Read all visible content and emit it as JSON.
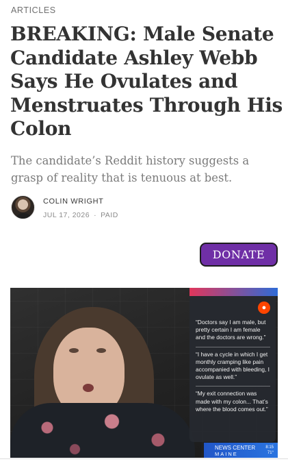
{
  "section": {
    "label": "ARTICLES"
  },
  "article": {
    "title": "BREAKING: Male Senate Candidate Ashley Webb Says He Ovulates and Menstruates Through His Colon",
    "subtitle": "The candidate’s Reddit history suggests a grasp of reality that is tenuous at best.",
    "author": "COLIN WRIGHT",
    "date": "JUL 17, 2026",
    "separator": "·",
    "access": "PAID"
  },
  "donate": {
    "label": "DONATE",
    "color": "#6f2fa6"
  },
  "image": {
    "quotes": [
      "“Doctors say I am male, but pretty certain I am female and the doctors are wrong.”",
      "“I have a cycle in which I get monthly cramping like pain accompanied with bleeding, I ovulate as well.”",
      "“My exit connection was made with my colon... That’s where the blood comes out.”"
    ],
    "news_name": "NEWS CENTER",
    "news_region": "MAINE",
    "news_time": "8:15",
    "news_temp": "71°",
    "icons": {
      "reddit": "reddit-icon",
      "news": "nbc-peacock-icon"
    }
  }
}
